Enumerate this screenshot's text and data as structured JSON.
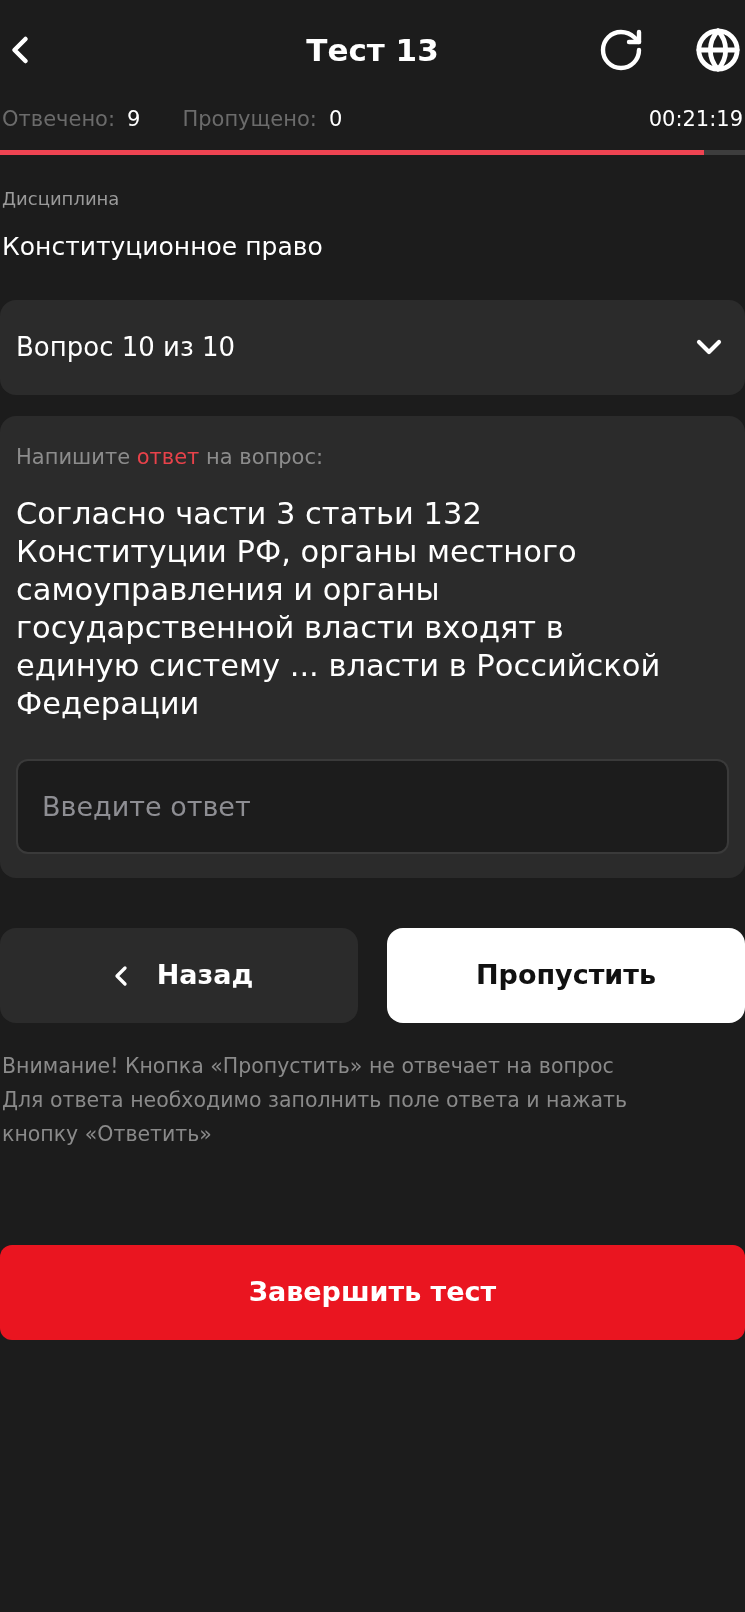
{
  "header": {
    "title": "Тест 13"
  },
  "stats": [
    {
      "label": "Отвечено:",
      "value": "9"
    },
    {
      "label": "Пропущено:",
      "value": "0"
    }
  ],
  "timer": "00:21:19",
  "progress": {
    "level": 0.945
  },
  "discipline": {
    "label": "Дисциплина",
    "value": "Конституционное право"
  },
  "question_selector": {
    "label": "Вопрос 10 из 10",
    "expanded": false
  },
  "question_card": {
    "prompt_parts": [
      {
        "text": "Напишите ",
        "highlight": false
      },
      {
        "text": "ответ",
        "highlight": true
      },
      {
        "text": " на вопрос:",
        "highlight": false
      }
    ],
    "question": "Согласно части 3 статьи 132 Конституции РФ, органы местного самоуправления и органы государственной власти входят в единую систему ... власти в Российской Федерации",
    "answer_field": {
      "placeholder": "Введите ответ"
    }
  },
  "buttons": [
    {
      "kind": "back",
      "label": "Назад"
    },
    {
      "kind": "skip",
      "label": "Пропустить"
    }
  ],
  "notice_lines": [
    "Внимание! Кнопка «Пропустить» не отвечает на вопрос",
    "Для ответа необходимо заполнить поле ответа и нажать",
    "кнопку «Ответить»"
  ],
  "finish_button": {
    "label": "Завершить тест"
  }
}
